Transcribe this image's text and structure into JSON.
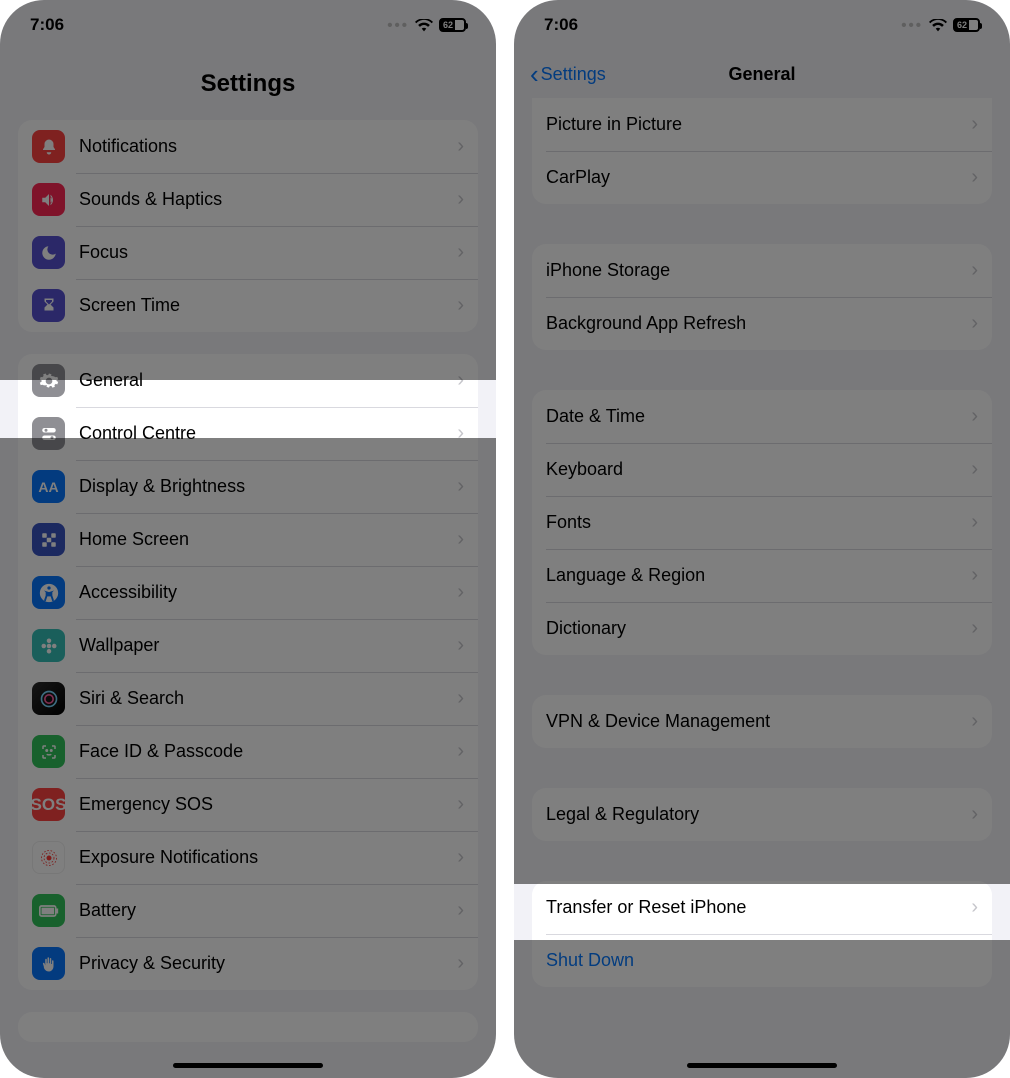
{
  "status": {
    "time": "7:06",
    "battery_pct": "62"
  },
  "phone1": {
    "title": "Settings",
    "groupA": [
      {
        "label": "Notifications"
      },
      {
        "label": "Sounds & Haptics"
      },
      {
        "label": "Focus"
      },
      {
        "label": "Screen Time"
      }
    ],
    "groupB": [
      {
        "label": "General"
      },
      {
        "label": "Control Centre"
      },
      {
        "label": "Display & Brightness"
      },
      {
        "label": "Home Screen"
      },
      {
        "label": "Accessibility"
      },
      {
        "label": "Wallpaper"
      },
      {
        "label": "Siri & Search"
      },
      {
        "label": "Face ID & Passcode"
      },
      {
        "label": "Emergency SOS"
      },
      {
        "label": "Exposure Notifications"
      },
      {
        "label": "Battery"
      },
      {
        "label": "Privacy & Security"
      }
    ]
  },
  "phone2": {
    "back": "Settings",
    "title": "General",
    "groupA": [
      {
        "label": "Picture in Picture"
      },
      {
        "label": "CarPlay"
      }
    ],
    "groupB": [
      {
        "label": "iPhone Storage"
      },
      {
        "label": "Background App Refresh"
      }
    ],
    "groupC": [
      {
        "label": "Date & Time"
      },
      {
        "label": "Keyboard"
      },
      {
        "label": "Fonts"
      },
      {
        "label": "Language & Region"
      },
      {
        "label": "Dictionary"
      }
    ],
    "groupD": [
      {
        "label": "VPN & Device Management"
      }
    ],
    "groupE": [
      {
        "label": "Legal & Regulatory"
      }
    ],
    "groupF": [
      {
        "label": "Transfer or Reset iPhone"
      },
      {
        "label": "Shut Down"
      }
    ]
  }
}
